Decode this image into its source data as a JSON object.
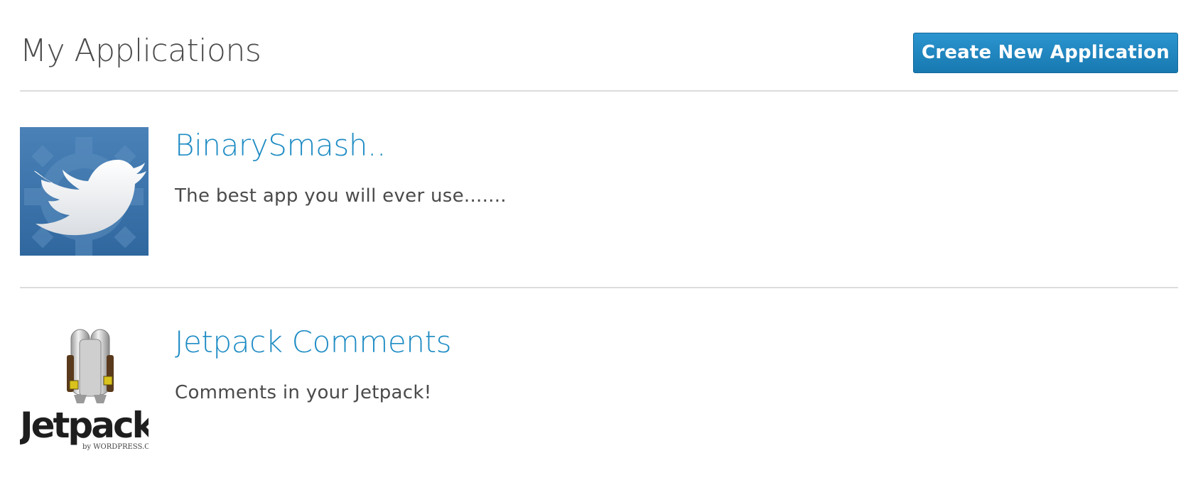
{
  "header": {
    "title": "My Applications",
    "create_button_label": "Create New Application"
  },
  "applications": [
    {
      "name": "BinarySmash..",
      "description": "The best app you will ever use.......",
      "icon": "twitter-bird-gear-icon"
    },
    {
      "name": "Jetpack Comments",
      "description": "Comments in your Jetpack!",
      "icon": "jetpack-logo",
      "logo_text": "Jetpack",
      "logo_subtext": "by WORDPRESS.COM"
    }
  ],
  "colors": {
    "accent": "#1e8cc4",
    "button": "#1a87c1",
    "title": "#4b4b4b",
    "text": "#4a4a4a",
    "divider": "#dcdcdc",
    "twitter_icon_bg": "#3a72aa"
  }
}
